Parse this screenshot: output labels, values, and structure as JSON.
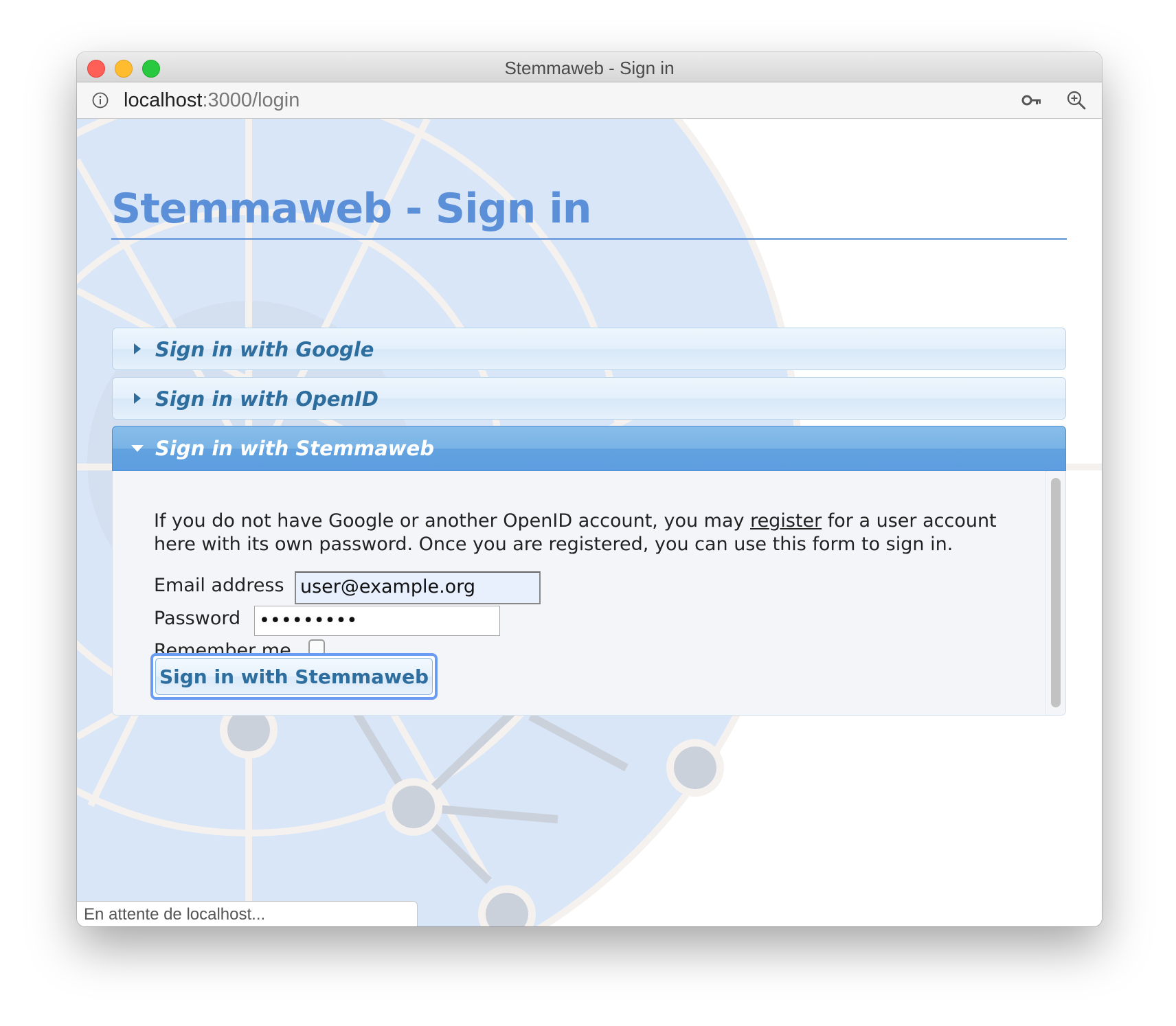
{
  "window": {
    "title": "Stemmaweb - Sign in"
  },
  "urlbar": {
    "host": "localhost",
    "path": ":3000/login",
    "icons": [
      "info-icon",
      "key-icon",
      "zoom-in-icon"
    ]
  },
  "page": {
    "title": "Stemmaweb - Sign in"
  },
  "accordion": {
    "sections": [
      {
        "label": "Sign in with Google",
        "expanded": false
      },
      {
        "label": "Sign in with OpenID",
        "expanded": false
      },
      {
        "label": "Sign in with Stemmaweb",
        "expanded": true
      }
    ]
  },
  "stemmaweb_panel": {
    "intro_before_link": "If you do not have Google or another OpenID account, you may ",
    "register_link": "register",
    "intro_after_link": " for a user account here with its own password. Once you are registered, you can use this form to sign in.",
    "email_label": "Email address",
    "email_value": "user@example.org",
    "password_label": "Password",
    "password_value": "•••••••••",
    "remember_label": "Remember me",
    "remember_checked": false,
    "submit_label": "Sign in with Stemmaweb"
  },
  "status_bar": {
    "text": "En attente de localhost..."
  },
  "colors": {
    "title_blue": "#5b8fd8",
    "accordion_text": "#2e6e9e",
    "active_header": "#6aa9e3",
    "background_circle": "#d8e6f8"
  }
}
